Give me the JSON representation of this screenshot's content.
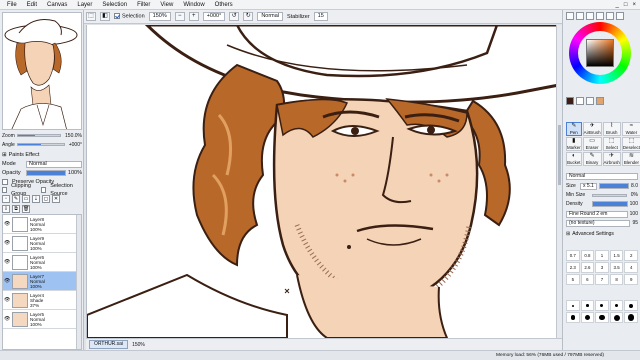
{
  "menubar": {
    "items": [
      "File",
      "Edit",
      "Canvas",
      "Layer",
      "Selection",
      "Filter",
      "View",
      "Window",
      "Others"
    ],
    "window_controls": [
      "_",
      "□",
      "×"
    ]
  },
  "toolbar": {
    "selection_label": "Selection",
    "zoom": "150%",
    "rotation": "+000°",
    "mode": "Normal",
    "stabilizer_label": "Stabilizer",
    "stabilizer_value": "15"
  },
  "navigator": {
    "zoom_label": "Zoom",
    "zoom_value": "150.0%",
    "zoom_fraction": 0.4,
    "angle_label": "Angle",
    "angle_value": "+000°",
    "angle_fraction": 0.5
  },
  "layer_props": {
    "paints_effect_label": "Paints Effect",
    "mode_label": "Mode",
    "mode_value": "Normal",
    "opacity_label": "Opacity",
    "opacity_value": "100%",
    "preserve_opacity_label": "Preserve Opacity",
    "clipping_group_label": "Clipping Group",
    "selection_source_label": "Selection Source"
  },
  "layers": [
    {
      "name": "Layer8",
      "mode": "Normal",
      "opacity": "100%",
      "selected": false,
      "thumb": "hat"
    },
    {
      "name": "Layer9",
      "mode": "Normal",
      "opacity": "100%",
      "selected": false,
      "thumb": "hat"
    },
    {
      "name": "Layer6",
      "mode": "Normal",
      "opacity": "100%",
      "selected": false,
      "thumb": "hat"
    },
    {
      "name": "Layer7",
      "mode": "Normal",
      "opacity": "100%",
      "selected": true,
      "thumb": "face"
    },
    {
      "name": "Layer4",
      "mode": "Shade",
      "opacity": "37%",
      "selected": false,
      "thumb": "face"
    },
    {
      "name": "Layer5",
      "mode": "Normal",
      "opacity": "100%",
      "selected": false,
      "thumb": "face"
    }
  ],
  "taskbar": {
    "file_name": "ORTHUR.sai",
    "file_zoom": "150%"
  },
  "status": {
    "memory": "Memory load: 56% (76MB used / 797MB reserved)"
  },
  "tools": [
    {
      "label": "Pen",
      "glyph": "✎",
      "active": true
    },
    {
      "label": "AirBrush",
      "glyph": "✈",
      "active": false
    },
    {
      "label": "Brush",
      "glyph": "⌇",
      "active": false
    },
    {
      "label": "Water",
      "glyph": "≈",
      "active": false
    },
    {
      "label": "Marker",
      "glyph": "▮",
      "active": false
    },
    {
      "label": "Eraser",
      "glyph": "▭",
      "active": false
    },
    {
      "label": "Select",
      "glyph": "⬚",
      "active": false
    },
    {
      "label": "Deselect",
      "glyph": "⬚",
      "active": false
    },
    {
      "label": "Bucket",
      "glyph": "◐",
      "active": false
    },
    {
      "label": "Binary",
      "glyph": "✎",
      "active": false
    },
    {
      "label": "Airbrush",
      "glyph": "✈",
      "active": false
    },
    {
      "label": "Blender",
      "glyph": "≋",
      "active": false
    }
  ],
  "brush": {
    "mode_value": "Normal",
    "size_label": "Size",
    "size_mult": "x 5.1",
    "size_value": "8.0",
    "min_size_label": "Min Size",
    "min_size_value": "0%",
    "density_label": "Density",
    "density_value": "100",
    "shape_value": "Fine Round 2 em",
    "shape_strength": "100",
    "texture_value": "(no texture)",
    "texture_strength": "95",
    "advanced_label": "Advanced Settings",
    "sizes": [
      "0.7",
      "0.8",
      "1",
      "1.5",
      "2",
      "2.3",
      "2.6",
      "3",
      "3.5",
      "4",
      "5",
      "6",
      "7",
      "8",
      "9"
    ],
    "dot_sizes": [
      2,
      2.5,
      3,
      3.5,
      4,
      4.5,
      5,
      5.5,
      6,
      6.5
    ]
  },
  "colors": {
    "accent": "#4b81d6",
    "selected_layer": "#9ec3f2",
    "hair": "#b8692a",
    "skin": "#f4d3b6",
    "line": "#3a1f12"
  }
}
